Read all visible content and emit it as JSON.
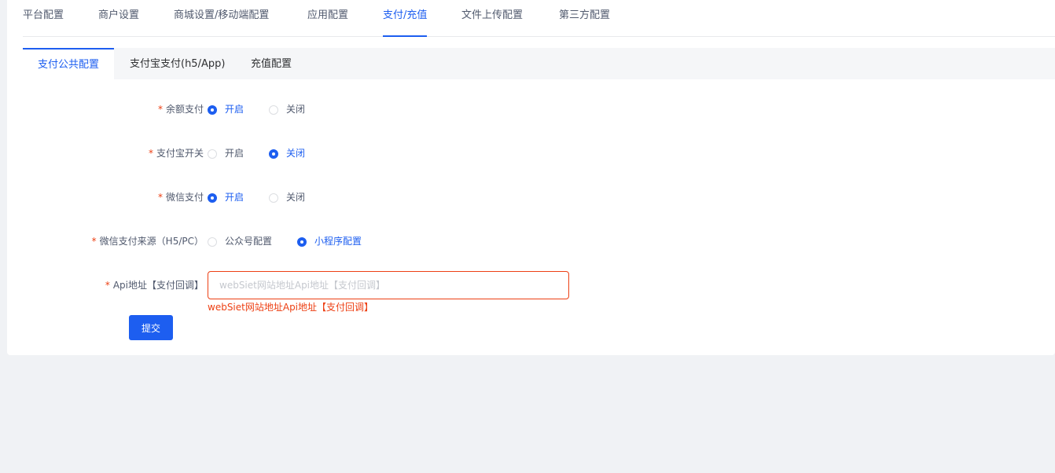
{
  "top_tabs": [
    {
      "label": "平台配置"
    },
    {
      "label": "商户设置"
    },
    {
      "label": "商城设置/移动端配置"
    },
    {
      "label": "应用配置"
    },
    {
      "label": "支付/充值"
    },
    {
      "label": "文件上传配置"
    },
    {
      "label": "第三方配置"
    }
  ],
  "active_top_tab": "支付/充值",
  "sub_tabs": [
    {
      "label": "支付公共配置"
    },
    {
      "label": "支付宝支付(h5/App)"
    },
    {
      "label": "充值配置"
    }
  ],
  "active_sub_tab": "支付公共配置",
  "form": {
    "required_mark": "*",
    "balance_pay": {
      "label": "余额支付",
      "options": [
        "开启",
        "关闭"
      ],
      "selected": "开启"
    },
    "alipay_switch": {
      "label": "支付宝开关",
      "options": [
        "开启",
        "关闭"
      ],
      "selected": "关闭"
    },
    "wechat_pay": {
      "label": "微信支付",
      "options": [
        "开启",
        "关闭"
      ],
      "selected": "开启"
    },
    "wechat_source": {
      "label": "微信支付来源（H5/PC）",
      "options": [
        "公众号配置",
        "小程序配置"
      ],
      "selected": "小程序配置"
    },
    "api_address": {
      "label": "Api地址【支付回调】",
      "value": "",
      "placeholder": "webSiet网站地址Api地址【支付回调】",
      "error": "webSiet网站地址Api地址【支付回调】"
    },
    "submit_label": "提交"
  },
  "colors": {
    "primary": "#1d5ef0",
    "error": "#ed4014",
    "background": "#f0f2f5"
  }
}
